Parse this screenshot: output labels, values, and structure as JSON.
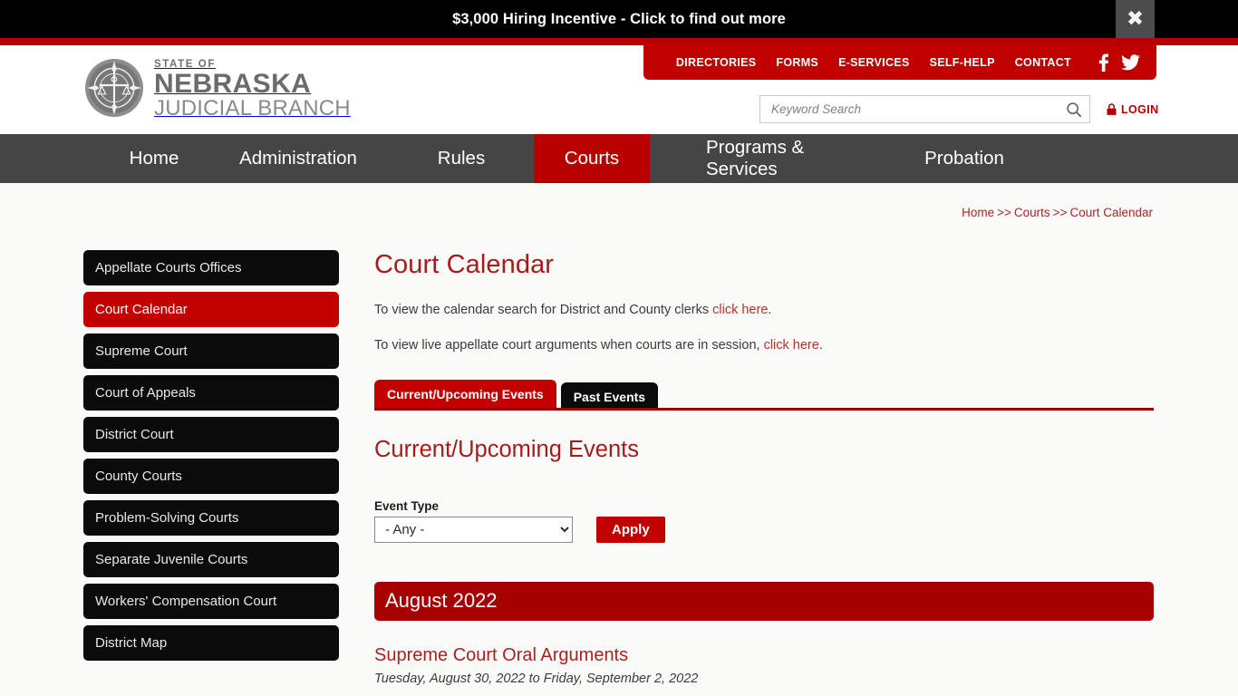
{
  "alert": {
    "text": "$3,000 Hiring Incentive - Click to find out more",
    "close_icon": "close-icon",
    "close_glyph": "✖"
  },
  "brand": {
    "line1": "STATE OF",
    "line2": "NEBRASKA",
    "line3": "JUDICIAL BRANCH",
    "seal_icon": "nebraska-judicial-seal-icon"
  },
  "utility_nav": {
    "items": [
      {
        "label": "DIRECTORIES"
      },
      {
        "label": "FORMS"
      },
      {
        "label": "E-SERVICES"
      },
      {
        "label": "SELF-HELP"
      },
      {
        "label": "CONTACT"
      }
    ],
    "social": [
      {
        "name": "facebook-icon"
      },
      {
        "name": "twitter-icon"
      }
    ]
  },
  "search": {
    "placeholder": "Keyword Search",
    "value": "",
    "icon": "search-icon",
    "login_label": "LOGIN",
    "login_icon": "lock-icon"
  },
  "main_nav": {
    "items": [
      {
        "label": "Home",
        "active": false
      },
      {
        "label": "Administration",
        "active": false
      },
      {
        "label": "Rules",
        "active": false
      },
      {
        "label": "Courts",
        "active": true
      },
      {
        "label": "Programs & Services",
        "active": false
      },
      {
        "label": "Probation",
        "active": false
      }
    ]
  },
  "breadcrumb": {
    "items": [
      {
        "label": "Home"
      },
      {
        "label": "Courts"
      },
      {
        "label": "Court Calendar"
      }
    ],
    "separator": ">>"
  },
  "sidebar": {
    "items": [
      {
        "label": "Appellate Courts Offices",
        "active": false
      },
      {
        "label": "Court Calendar",
        "active": true
      },
      {
        "label": "Supreme Court",
        "active": false
      },
      {
        "label": "Court of Appeals",
        "active": false
      },
      {
        "label": "District Court",
        "active": false
      },
      {
        "label": "County Courts",
        "active": false
      },
      {
        "label": "Problem-Solving Courts",
        "active": false
      },
      {
        "label": "Separate Juvenile Courts",
        "active": false
      },
      {
        "label": "Workers' Compensation Court",
        "active": false
      },
      {
        "label": "District Map",
        "active": false
      }
    ]
  },
  "main": {
    "title": "Court Calendar",
    "para1_before": "To view the calendar search for District and County clerks ",
    "para1_link": "click here",
    "para1_after": ".",
    "para2_before": "To view live appellate court arguments when courts are in session, ",
    "para2_link": "click here",
    "para2_after": ".",
    "tabs": [
      {
        "label": "Current/Upcoming Events",
        "active": true
      },
      {
        "label": "Past Events",
        "active": false
      }
    ],
    "section_title": "Current/Upcoming Events",
    "filter": {
      "label": "Event Type",
      "selected": "- Any -",
      "options": [
        "- Any -"
      ],
      "apply_label": "Apply"
    },
    "month_banner": "August 2022",
    "events": [
      {
        "title": "Supreme Court Oral Arguments",
        "date": "Tuesday, August 30, 2022 to Friday, September 2, 2022"
      }
    ]
  },
  "colors": {
    "brand_red": "#c10000",
    "dark_red": "#a70000",
    "nav_gray": "#454545",
    "black": "#0b0b0b",
    "link_red": "#a81b1b",
    "page_bg": "#fafaf8"
  }
}
